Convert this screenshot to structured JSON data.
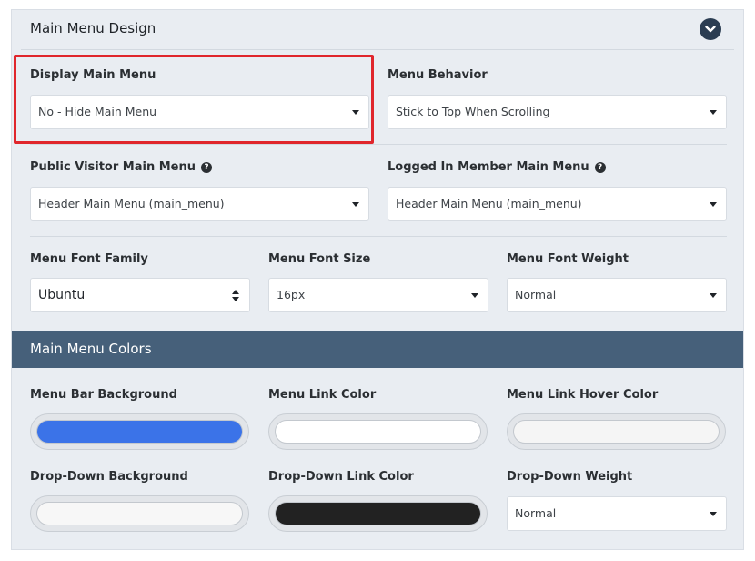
{
  "section": {
    "title": "Main Menu Design"
  },
  "fields": {
    "display_main_menu": {
      "label": "Display Main Menu",
      "value": "No - Hide Main Menu"
    },
    "menu_behavior": {
      "label": "Menu Behavior",
      "value": "Stick to Top When Scrolling"
    },
    "public_visitor_main_menu": {
      "label": "Public Visitor Main Menu",
      "value": "Header Main Menu (main_menu)",
      "help": "?"
    },
    "logged_in_member_main_menu": {
      "label": "Logged In Member Main Menu",
      "value": "Header Main Menu (main_menu)",
      "help": "?"
    },
    "menu_font_family": {
      "label": "Menu Font Family",
      "value": "Ubuntu"
    },
    "menu_font_size": {
      "label": "Menu Font Size",
      "value": "16px"
    },
    "menu_font_weight": {
      "label": "Menu Font Weight",
      "value": "Normal"
    }
  },
  "colors_section": {
    "title": "Main Menu Colors",
    "menu_bar_background": {
      "label": "Menu Bar Background",
      "color": "#3b73e8"
    },
    "menu_link_color": {
      "label": "Menu Link Color",
      "color": "#ffffff"
    },
    "menu_link_hover_color": {
      "label": "Menu Link Hover Color",
      "color": "#f5f5f5"
    },
    "dropdown_background": {
      "label": "Drop-Down Background",
      "color": "#f7f7f7"
    },
    "dropdown_link_color": {
      "label": "Drop-Down Link Color",
      "color": "#222222"
    },
    "dropdown_weight": {
      "label": "Drop-Down Weight",
      "value": "Normal"
    }
  },
  "icons": {
    "collapse": "chevron-down-icon",
    "help": "question-circle-icon",
    "select_caret": "caret-down-icon"
  }
}
